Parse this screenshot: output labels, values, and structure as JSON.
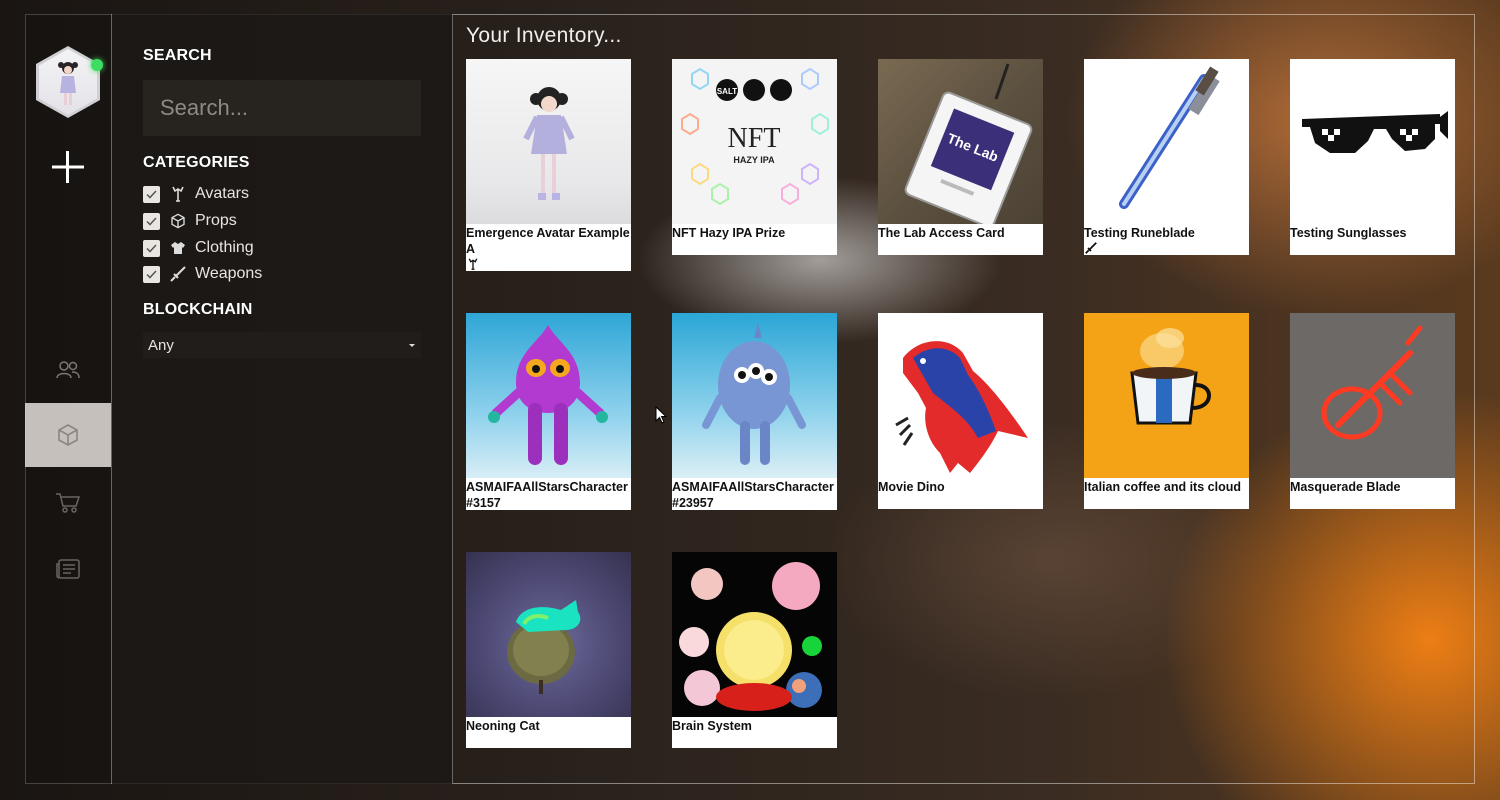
{
  "search": {
    "title": "SEARCH",
    "placeholder": "Search..."
  },
  "categories": {
    "title": "CATEGORIES",
    "items": [
      {
        "label": "Avatars",
        "icon": "avatar-icon",
        "checked": true
      },
      {
        "label": "Props",
        "icon": "cube-icon",
        "checked": true
      },
      {
        "label": "Clothing",
        "icon": "shirt-icon",
        "checked": true
      },
      {
        "label": "Weapons",
        "icon": "sword-icon",
        "checked": true
      }
    ]
  },
  "blockchain": {
    "title": "BLOCKCHAIN",
    "selected": "Any"
  },
  "inventory": {
    "title": "Your Inventory...",
    "items": [
      {
        "name": "Emergence Avatar Example A",
        "tag_icon": "avatar-icon"
      },
      {
        "name": "NFT Hazy IPA Prize",
        "thumb_text": "NFT",
        "thumb_subtext": "HAZY IPA",
        "thumb_brand": "SALT"
      },
      {
        "name": "The Lab Access Card",
        "thumb_text": "The Lab"
      },
      {
        "name": "Testing Runeblade",
        "tag_icon": "sword-icon"
      },
      {
        "name": "Testing Sunglasses"
      },
      {
        "name": "ASMAIFAAllStarsCharacter #3157"
      },
      {
        "name": "ASMAIFAAllStarsCharacter #23957"
      },
      {
        "name": "Movie Dino"
      },
      {
        "name": "Italian coffee and its cloud"
      },
      {
        "name": "Masquerade Blade"
      },
      {
        "name": "Neoning Cat"
      },
      {
        "name": "Brain System"
      }
    ]
  },
  "colors": {
    "online": "#3ddc63",
    "panel": "#1c1916",
    "accent_orange": "#f5a623"
  }
}
